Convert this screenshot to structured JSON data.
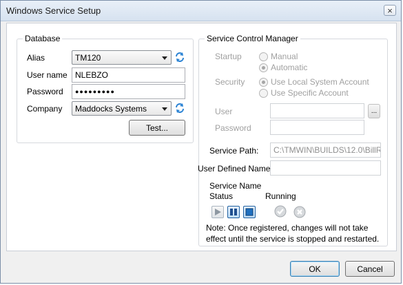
{
  "window": {
    "title": "Windows Service Setup",
    "close_glyph": "×"
  },
  "database": {
    "legend": "Database",
    "alias": {
      "label": "Alias",
      "value": "TM120"
    },
    "username": {
      "label": "User name",
      "value": "NLEBZO"
    },
    "password": {
      "label": "Password",
      "value": "●●●●●●●●●"
    },
    "company": {
      "label": "Company",
      "value": "Maddocks Systems"
    },
    "test_button": "Test..."
  },
  "scm": {
    "legend": "Service Control Manager",
    "startup": {
      "label": "Startup",
      "options": [
        "Manual",
        "Automatic"
      ],
      "selected": "Automatic"
    },
    "security": {
      "label": "Security",
      "options": [
        "Use Local System Account",
        "Use Specific Account"
      ],
      "selected": "Use Local System Account"
    },
    "user": {
      "label": "User",
      "value": "",
      "browse": "..."
    },
    "password": {
      "label": "Password",
      "value": ""
    },
    "service_path": {
      "label": "Service Path:",
      "value": "C:\\TMWIN\\BUILDS\\12.0\\BillR"
    },
    "user_defined_name": {
      "label": "User Defined Name",
      "value": ""
    },
    "service_name_label": "Service Name",
    "status_label": "Status",
    "status_value": "Running",
    "note": "Note:  Once registered, changes will not take effect until the service is stopped and restarted."
  },
  "buttons": {
    "ok": "OK",
    "cancel": "Cancel"
  },
  "colors": {
    "accent": "#1f6fbf",
    "disabled_text": "#a0a0a0"
  }
}
